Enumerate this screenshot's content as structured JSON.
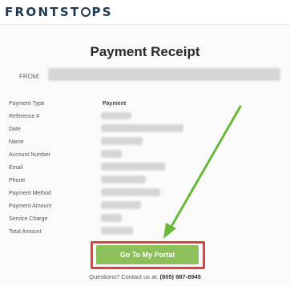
{
  "brand": {
    "logo_pre": "FRONTST",
    "logo_post": "PS"
  },
  "receipt": {
    "title": "Payment Receipt",
    "from_label": "FROM:",
    "rows": [
      {
        "label": "Payment Type",
        "value": "Payment"
      },
      {
        "label": "Reference #",
        "value": ""
      },
      {
        "label": "Date",
        "value": ""
      },
      {
        "label": "Name",
        "value": ""
      },
      {
        "label": "Account Number",
        "value": ""
      },
      {
        "label": "Email",
        "value": ""
      },
      {
        "label": "Phone",
        "value": ""
      },
      {
        "label": "Payment Method",
        "value": ""
      },
      {
        "label": "Payment Amount",
        "value": ""
      },
      {
        "label": "Service Charge",
        "value": ""
      },
      {
        "label": "Total Amount",
        "value": ""
      }
    ]
  },
  "portal_button": {
    "label": "Go To My Portal"
  },
  "footer": {
    "text": "Questions? Contact us at:",
    "phone": "(805) 987-8945"
  },
  "colors": {
    "button": "#8cc15a",
    "highlight": "#e0413c",
    "arrow": "#6ab83a",
    "logo": "#1f3a4f"
  }
}
